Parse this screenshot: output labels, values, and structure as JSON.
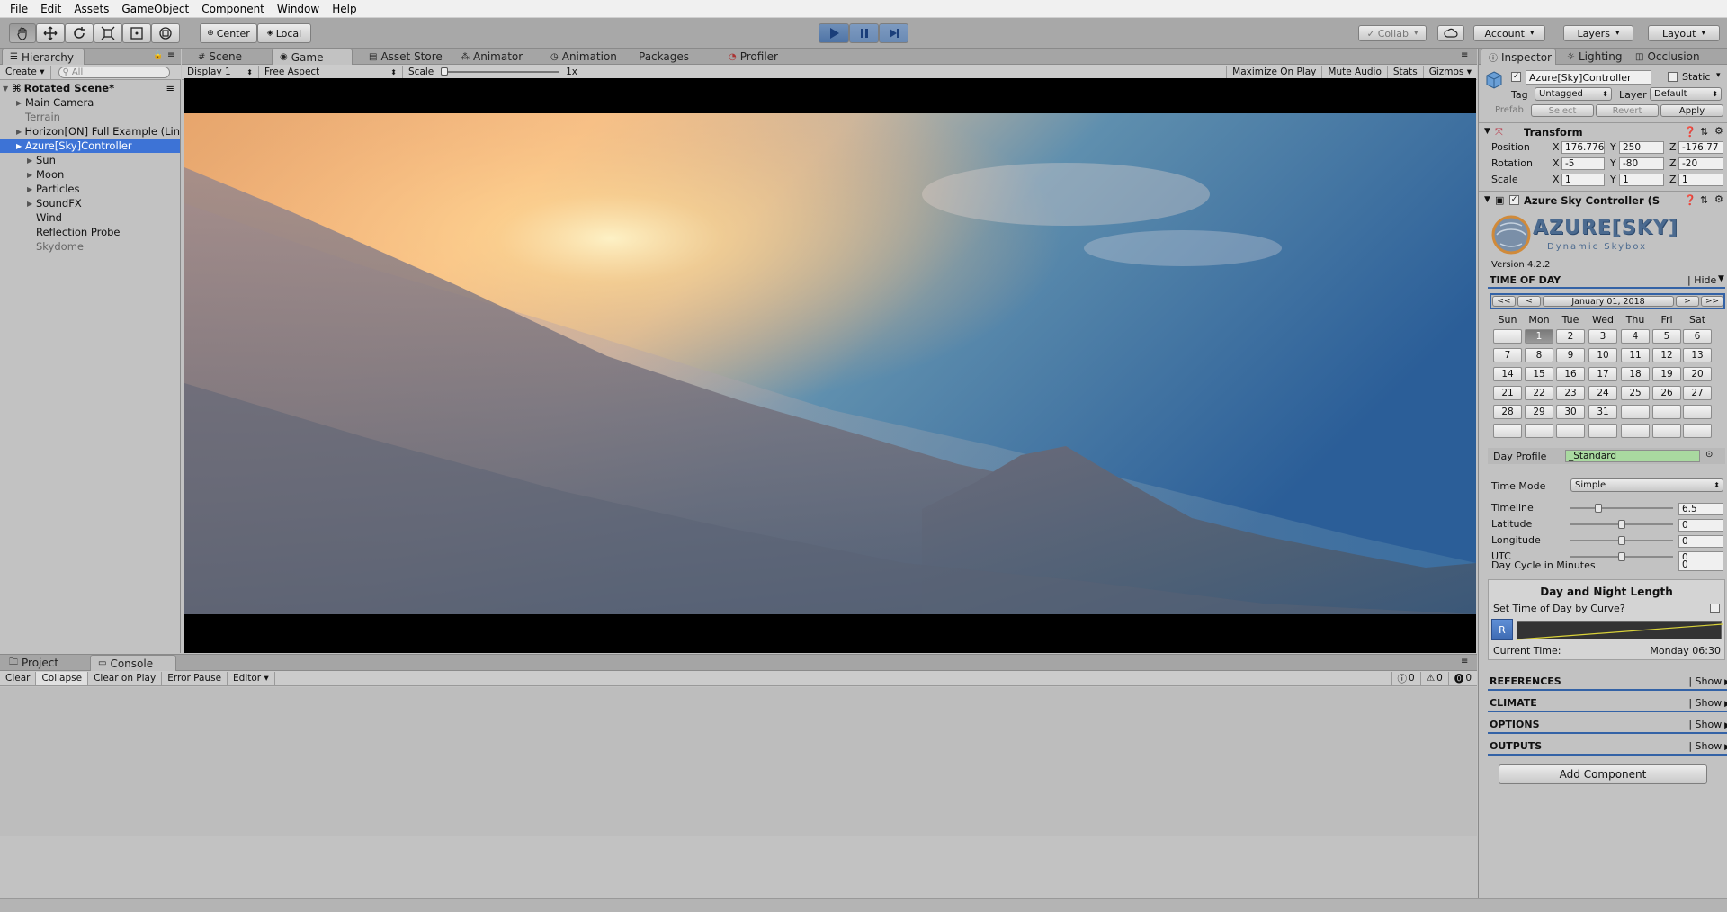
{
  "menu": [
    "File",
    "Edit",
    "Assets",
    "GameObject",
    "Component",
    "Window",
    "Help"
  ],
  "toolbar": {
    "center_label": "Center",
    "local_label": "Local",
    "collab_label": "Collab",
    "account_label": "Account",
    "layers_label": "Layers",
    "layout_label": "Layout",
    "accent_color": "#4f74a6"
  },
  "hierarchy": {
    "tab": "Hierarchy",
    "create_label": "Create",
    "search_placeholder": "All",
    "scene": "Rotated Scene*",
    "items": [
      {
        "label": "Main Camera",
        "depth": 1,
        "arrow": true,
        "state": "normal"
      },
      {
        "label": "Terrain",
        "depth": 1,
        "arrow": false,
        "state": "grey"
      },
      {
        "label": "Horizon[ON] Full Example (Lin",
        "depth": 1,
        "arrow": true,
        "state": "normal"
      },
      {
        "label": "Azure[Sky]Controller",
        "depth": 1,
        "arrow": true,
        "state": "selected"
      },
      {
        "label": "Sun",
        "depth": 2,
        "arrow": true,
        "state": "normal"
      },
      {
        "label": "Moon",
        "depth": 2,
        "arrow": true,
        "state": "normal"
      },
      {
        "label": "Particles",
        "depth": 2,
        "arrow": true,
        "state": "normal"
      },
      {
        "label": "SoundFX",
        "depth": 2,
        "arrow": true,
        "state": "normal"
      },
      {
        "label": "Wind",
        "depth": 2,
        "arrow": false,
        "state": "normal"
      },
      {
        "label": "Reflection Probe",
        "depth": 2,
        "arrow": false,
        "state": "normal"
      },
      {
        "label": "Skydome",
        "depth": 2,
        "arrow": false,
        "state": "grey"
      }
    ]
  },
  "center_tabs": [
    "Scene",
    "Game",
    "Asset Store",
    "Animator",
    "Animation",
    "Packages",
    "Profiler"
  ],
  "game_bar": {
    "display": "Display 1",
    "aspect": "Free Aspect",
    "scale_label": "Scale",
    "scale_value": "1x",
    "maximize": "Maximize On Play",
    "mute": "Mute Audio",
    "stats": "Stats",
    "gizmos": "Gizmos"
  },
  "bottom_tabs": [
    "Project",
    "Console"
  ],
  "console_bar": {
    "clear": "Clear",
    "collapse": "Collapse",
    "clear_on_play": "Clear on Play",
    "error_pause": "Error Pause",
    "editor": "Editor",
    "info_count": "0",
    "warn_count": "0",
    "error_count": "0"
  },
  "inspector": {
    "tabs": [
      "Inspector",
      "Lighting",
      "Occlusion"
    ],
    "object_name": "Azure[Sky]Controller",
    "static_label": "Static",
    "tag_label": "Tag",
    "tag_value": "Untagged",
    "layer_label": "Layer",
    "layer_value": "Default",
    "prefab_label": "Prefab",
    "select_label": "Select",
    "revert_label": "Revert",
    "apply_label": "Apply",
    "transform": {
      "title": "Transform",
      "position_label": "Position",
      "rotation_label": "Rotation",
      "scale_label": "Scale",
      "px": "176.776",
      "py": "250",
      "pz": "-176.77",
      "rx": "-5",
      "ry": "-80",
      "rz": "-20",
      "sx": "1",
      "sy": "1",
      "sz": "1"
    },
    "component_title": "Azure Sky Controller (S",
    "logo_text": "AZURE[SKY]",
    "logo_sub": "Dynamic Skybox",
    "version": "Version 4.2.2",
    "time_of_day": "TIME OF DAY",
    "hide_label": "| Hide",
    "nav": {
      "first": "<<",
      "prev": "<",
      "date": "January 01, 2018",
      "next": ">",
      "last": ">>"
    },
    "weekdays": [
      "Sun",
      "Mon",
      "Tue",
      "Wed",
      "Thu",
      "Fri",
      "Sat"
    ],
    "calendar": [
      [
        "",
        "1",
        "2",
        "3",
        "4",
        "5",
        "6"
      ],
      [
        "7",
        "8",
        "9",
        "10",
        "11",
        "12",
        "13"
      ],
      [
        "14",
        "15",
        "16",
        "17",
        "18",
        "19",
        "20"
      ],
      [
        "21",
        "22",
        "23",
        "24",
        "25",
        "26",
        "27"
      ],
      [
        "28",
        "29",
        "30",
        "31",
        "",
        "",
        ""
      ],
      [
        "",
        "",
        "",
        "",
        "",
        "",
        ""
      ]
    ],
    "selected_day": "1",
    "day_profile_label": "Day Profile",
    "day_profile_value": "_Standard",
    "time_mode_label": "Time Mode",
    "time_mode_value": "Simple",
    "sliders": [
      {
        "label": "Timeline",
        "value": "6.5",
        "fraction": 0.27
      },
      {
        "label": "Latitude",
        "value": "0",
        "fraction": 0.5
      },
      {
        "label": "Longitude",
        "value": "0",
        "fraction": 0.5
      },
      {
        "label": "UTC",
        "value": "0",
        "fraction": 0.5
      }
    ],
    "day_cycle_label": "Day Cycle in Minutes",
    "day_cycle_value": "0",
    "dnl_title": "Day and Night Length",
    "curve_label": "Set Time of Day by Curve?",
    "r_label": "R",
    "current_time_label": "Current Time:",
    "current_time_value": "Monday 06:30",
    "sections": [
      {
        "name": "REFERENCES",
        "action": "| Show"
      },
      {
        "name": "CLIMATE",
        "action": "| Show"
      },
      {
        "name": "OPTIONS",
        "action": "| Show"
      },
      {
        "name": "OUTPUTS",
        "action": "| Show"
      }
    ],
    "add_component": "Add Component"
  }
}
